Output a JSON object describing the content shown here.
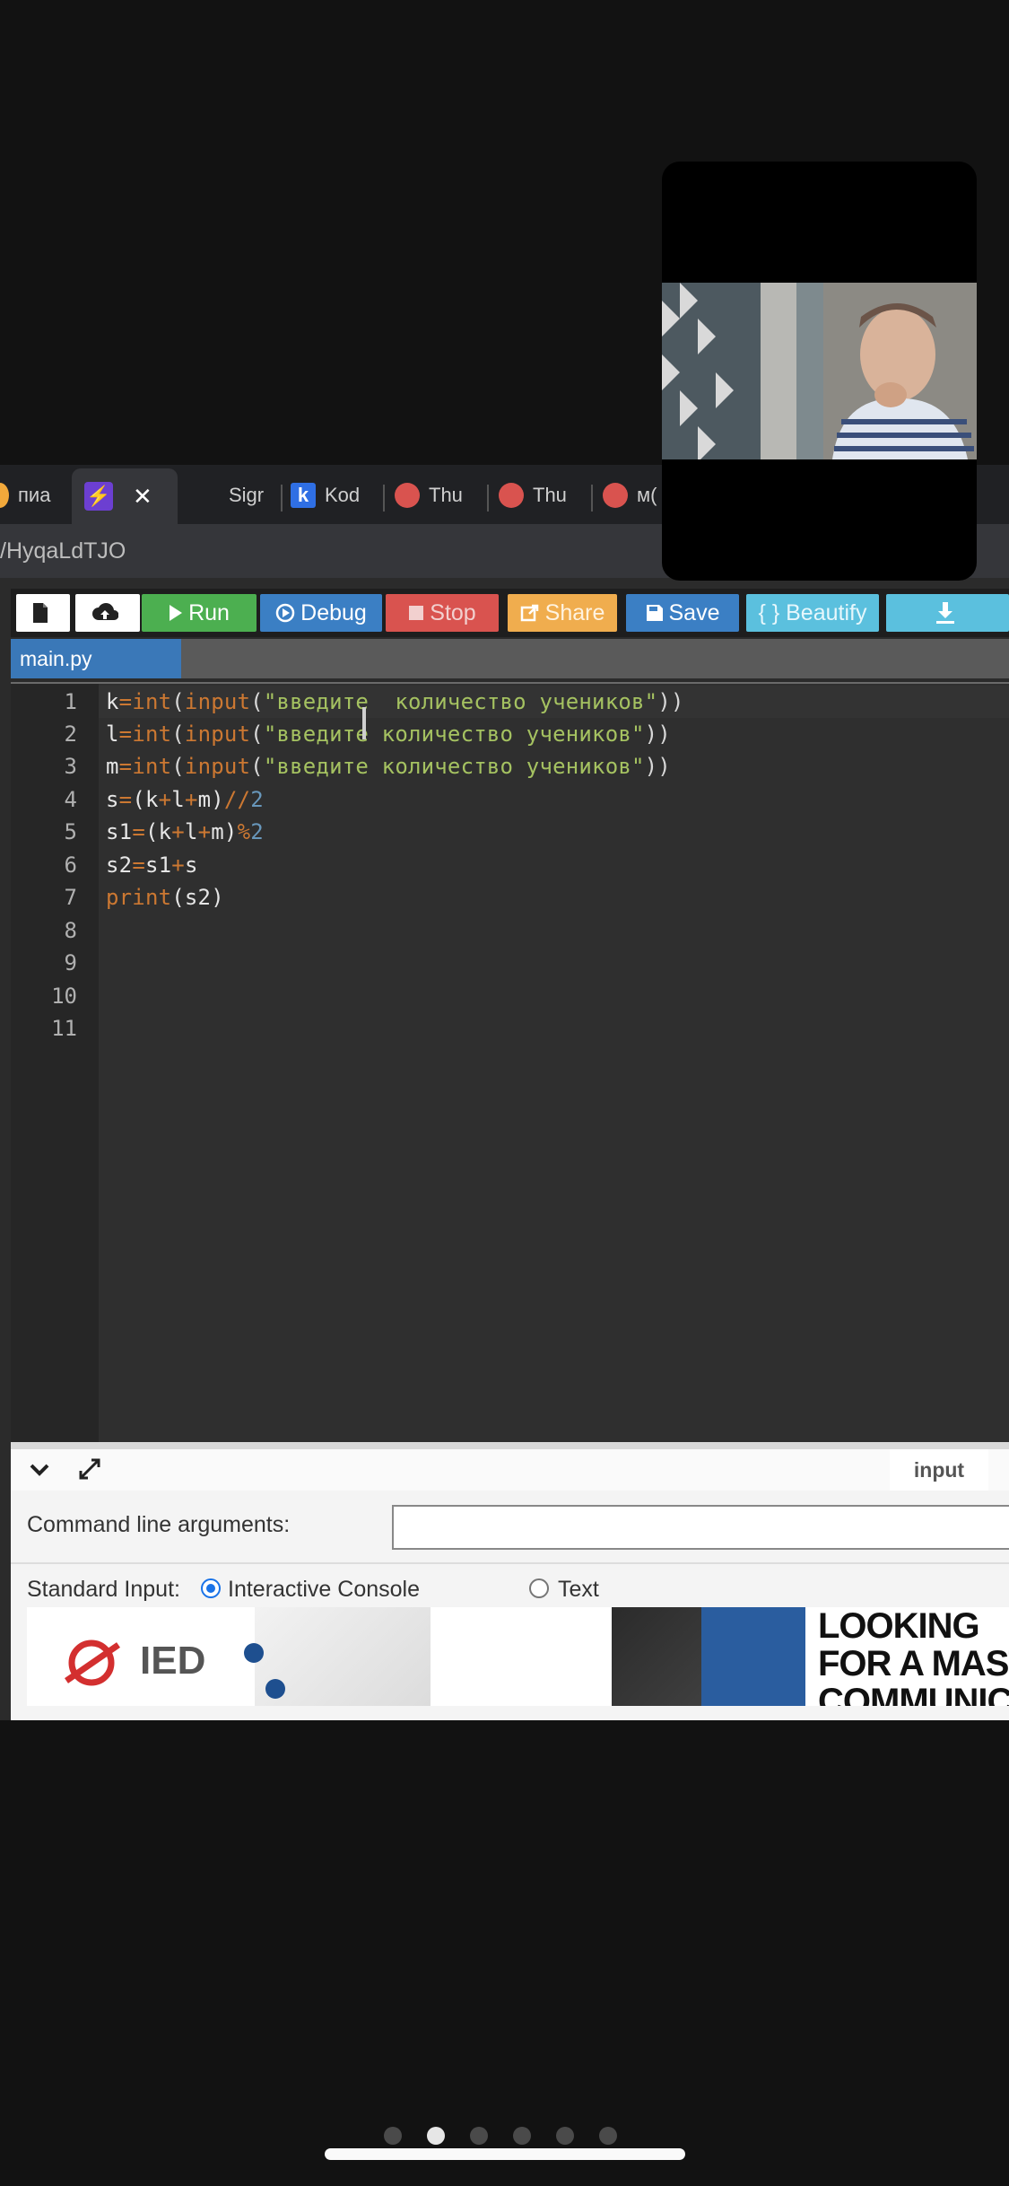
{
  "browser": {
    "tabs": [
      {
        "label": "пиа"
      },
      {
        "label": ""
      },
      {
        "label": "Sigr"
      },
      {
        "label": "Kod"
      },
      {
        "label": "Thu"
      },
      {
        "label": "Thu"
      },
      {
        "label": "м("
      }
    ],
    "close_glyph": "✕",
    "url_fragment": "/HyqaLdTJO"
  },
  "toolbar": {
    "run": "Run",
    "debug": "Debug",
    "stop": "Stop",
    "share": "Share",
    "save": "Save",
    "beautify": "{ } Beautify"
  },
  "editor": {
    "file_tab": "main.py",
    "line_numbers": [
      "1",
      "2",
      "3",
      "4",
      "5",
      "6",
      "7",
      "8",
      "9",
      "10",
      "11"
    ],
    "code": {
      "l1": {
        "a": "k",
        "b": "=",
        "c": "int",
        "d": "(",
        "e": "input",
        "f": "(",
        "g": "\"введите  количество учеников\"",
        "h": "))"
      },
      "l2": {
        "a": "l",
        "b": "=",
        "c": "int",
        "d": "(",
        "e": "input",
        "f": "(",
        "g": "\"введите количество учеников\"",
        "h": "))"
      },
      "l3": {
        "a": "m",
        "b": "=",
        "c": "int",
        "d": "(",
        "e": "input",
        "f": "(",
        "g": "\"введите количество учеников\"",
        "h": "))"
      },
      "l4": {
        "a": "s",
        "b": "=",
        "c": "(k",
        "d": "+",
        "e": "l",
        "f": "+",
        "g": "m)",
        "h": "//",
        "i": "2"
      },
      "l5": {
        "a": "s1",
        "b": "=",
        "c": "(k",
        "d": "+",
        "e": "l",
        "f": "+",
        "g": "m)",
        "h": "%",
        "i": "2"
      },
      "l6": {
        "a": "s2",
        "b": "=",
        "c": "s1",
        "d": "+",
        "e": "s"
      },
      "l7": {
        "a": "print",
        "b": "(s2)"
      }
    }
  },
  "bottom_panel": {
    "input_tab": "input",
    "cmd_label": "Command line arguments:",
    "stdin_label": "Standard Input:",
    "option_interactive": "Interactive Console",
    "option_text": "Text"
  },
  "ad": {
    "logo": "IED",
    "headline_1": "LOOKING",
    "headline_2": "FOR A MASTER",
    "headline_3": "COMMUNICATIO"
  },
  "pager": {
    "count": 6,
    "active_index": 1
  }
}
